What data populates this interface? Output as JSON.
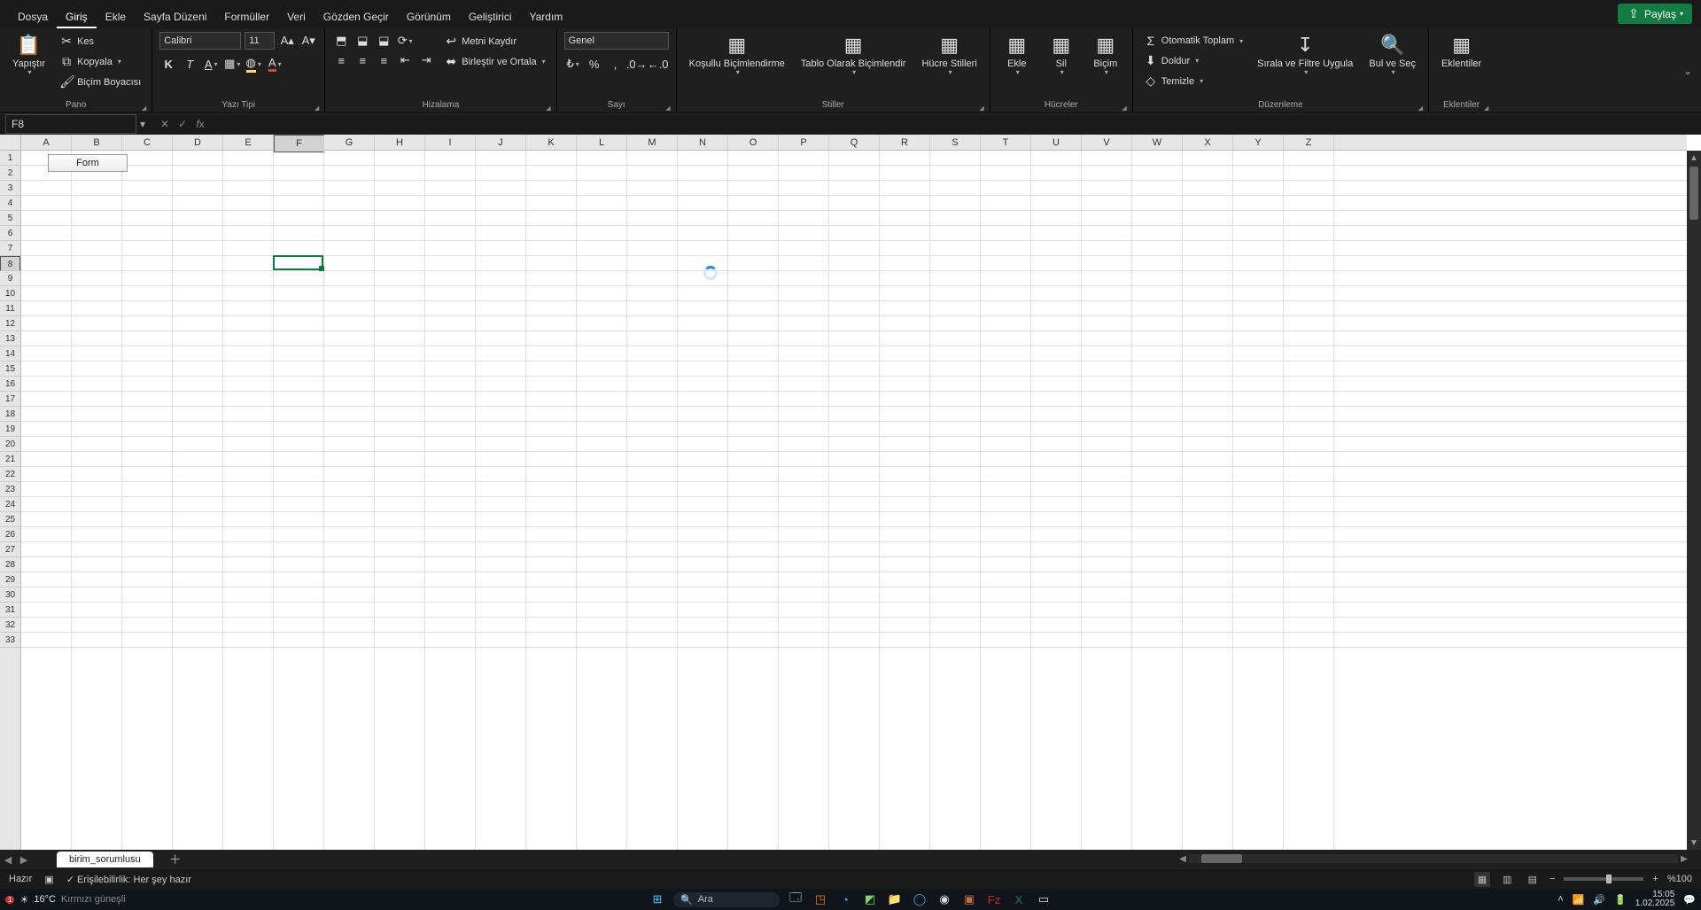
{
  "tabs": {
    "file": "Dosya",
    "home": "Giriş",
    "insert": "Ekle",
    "layout": "Sayfa Düzeni",
    "formulas": "Formüller",
    "data": "Veri",
    "review": "Gözden Geçir",
    "view": "Görünüm",
    "developer": "Geliştirici",
    "help": "Yardım"
  },
  "share_label": "Paylaş",
  "clipboard": {
    "paste": "Yapıştır",
    "cut": "Kes",
    "copy": "Kopyala",
    "painter": "Biçim Boyacısı",
    "group": "Pano"
  },
  "font": {
    "name": "Calibri",
    "size": "11",
    "group": "Yazı Tipi"
  },
  "align": {
    "wrap": "Metni Kaydır",
    "merge": "Birleştir ve Ortala",
    "group": "Hizalama"
  },
  "number": {
    "format": "Genel",
    "group": "Sayı"
  },
  "styles": {
    "cond": "Koşullu Biçimlendirme",
    "table": "Tablo Olarak Biçimlendir",
    "cell": "Hücre Stilleri",
    "group": "Stiller"
  },
  "cells": {
    "insert": "Ekle",
    "delete": "Sil",
    "format": "Biçim",
    "group": "Hücreler"
  },
  "editing": {
    "sum": "Otomatik Toplam",
    "fill": "Doldur",
    "clear": "Temizle",
    "sort": "Sırala ve Filtre Uygula",
    "find": "Bul ve Seç",
    "group": "Düzenleme"
  },
  "addins": {
    "label": "Eklentiler",
    "group": "Eklentiler"
  },
  "name_box": "F8",
  "formula": "",
  "columns": [
    "A",
    "B",
    "C",
    "D",
    "E",
    "F",
    "G",
    "H",
    "I",
    "J",
    "K",
    "L",
    "M",
    "N",
    "O",
    "P",
    "Q",
    "R",
    "S",
    "T",
    "U",
    "V",
    "W",
    "X",
    "Y",
    "Z"
  ],
  "visible_rows": 33,
  "selected_col_index": 5,
  "selected_row_index": 7,
  "form_button_label": "Form",
  "sheet_tab": "birim_sorumlusu",
  "status_ready": "Hazır",
  "status_a11y": "Erişilebilirlik: Her şey hazır",
  "zoom_label": "%100",
  "taskbar": {
    "temp": "16°C",
    "weather": "Kırmızı güneşli",
    "search_placeholder": "Ara",
    "time": "15:05",
    "date": "1.02.2025"
  },
  "colors": {
    "excel_green": "#107c41",
    "fill_swatch": "#ffd966",
    "font_swatch": "#d64040"
  }
}
